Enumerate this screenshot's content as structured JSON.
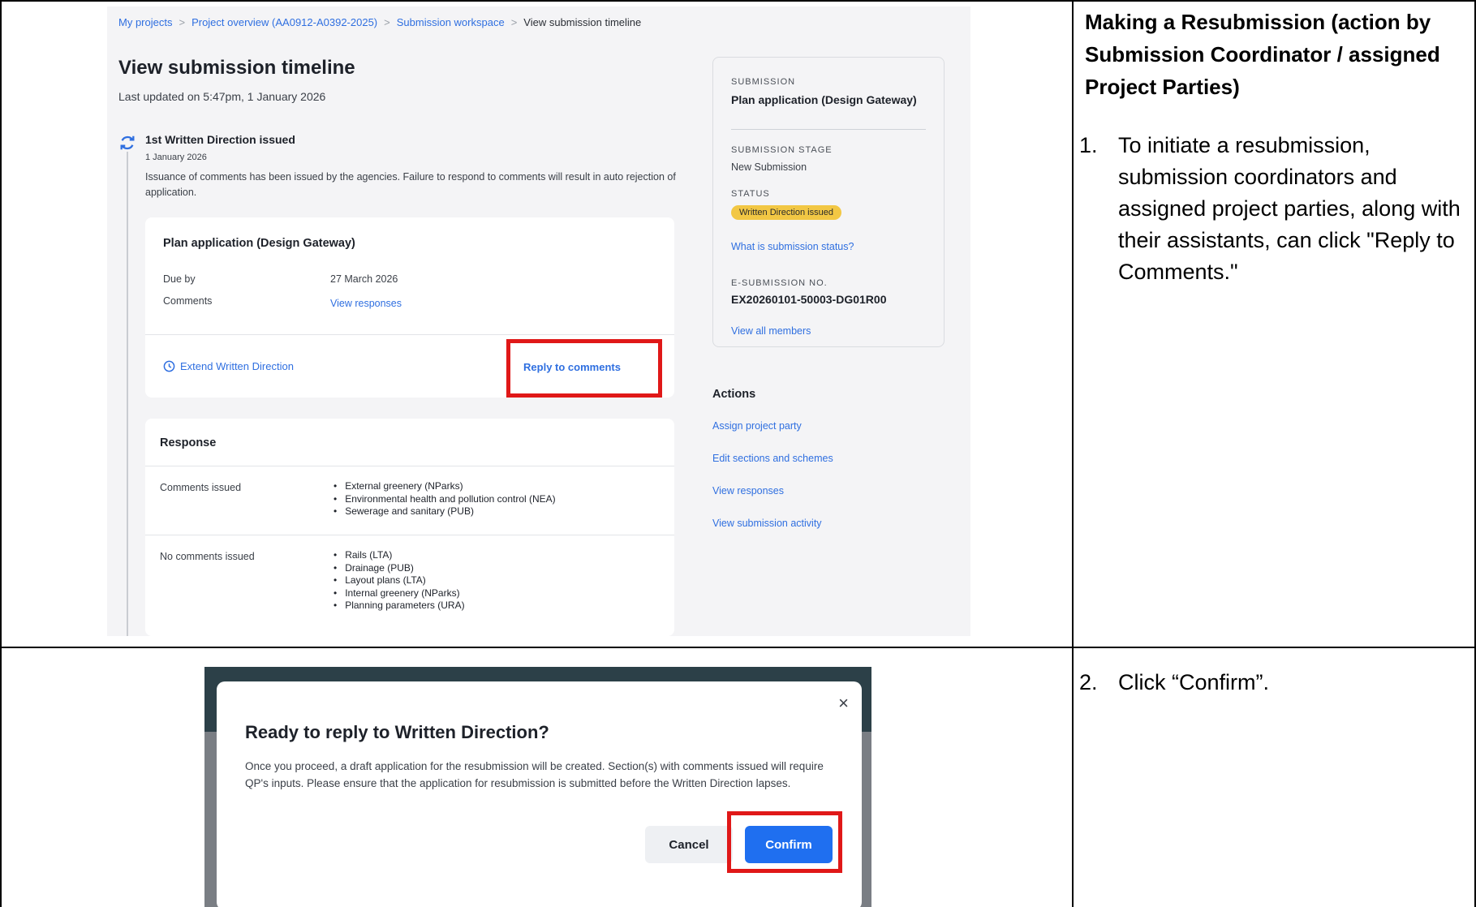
{
  "breadcrumb": {
    "items": [
      "My projects",
      "Project overview (AA0912-A0392-2025)",
      "Submission workspace"
    ],
    "current": "View submission timeline"
  },
  "page": {
    "title": "View submission timeline",
    "last_updated": "Last updated on 5:47pm, 1 January 2026"
  },
  "timeline": {
    "event_title": "1st Written Direction issued",
    "event_date": "1 January 2026",
    "event_desc": "Issuance of comments has been issued by the agencies. Failure to respond to comments will result in auto rejection of application."
  },
  "plan_card": {
    "title": "Plan application (Design Gateway)",
    "due_label": "Due by",
    "due_value": "27 March 2026",
    "comments_label": "Comments",
    "comments_link": "View responses",
    "extend_link": "Extend Written Direction",
    "reply_button": "Reply to comments"
  },
  "response_card": {
    "title": "Response",
    "issued_label": "Comments issued",
    "issued_items": [
      "External greenery (NParks)",
      "Environmental health and pollution control (NEA)",
      "Sewerage and sanitary (PUB)"
    ],
    "none_label": "No comments issued",
    "none_items": [
      "Rails (LTA)",
      "Drainage (PUB)",
      "Layout plans (LTA)",
      "Internal greenery (NParks)",
      "Planning parameters (URA)"
    ]
  },
  "side_panel": {
    "submission_cap": "SUBMISSION",
    "submission_value": "Plan application (Design Gateway)",
    "stage_cap": "SUBMISSION STAGE",
    "stage_value": "New Submission",
    "status_cap": "STATUS",
    "status_value": "Written Direction issued",
    "status_help": "What is submission status?",
    "esub_cap": "E-SUBMISSION NO.",
    "esub_value": "EX20260101-50003-DG01R00",
    "members_link": "View all members"
  },
  "actions": {
    "title": "Actions",
    "links": [
      "Assign project party",
      "Edit sections and schemes",
      "View responses",
      "View submission activity"
    ]
  },
  "instructions": {
    "heading": "Making a Resubmission (action by Submission Coordinator / assigned Project Parties)",
    "step1_num": "1.",
    "step1_text": "To initiate a resubmission, submission coordinators and assigned project parties, along with their assistants, can click \"Reply to Comments.\"",
    "step2_num": "2.",
    "step2_text": "Click “Confirm”."
  },
  "modal": {
    "close": "×",
    "title": "Ready to reply to Written Direction?",
    "body": "Once you proceed, a draft application for the resubmission will be created. Section(s) with comments issued will require QP's inputs. Please ensure that the application for resubmission is submitted before the Written Direction lapses.",
    "cancel": "Cancel",
    "confirm": "Confirm"
  },
  "colors": {
    "link": "#2f6fe0",
    "highlight": "#e01818",
    "status_pill": "#f2c744",
    "confirm": "#1f6ff0"
  }
}
